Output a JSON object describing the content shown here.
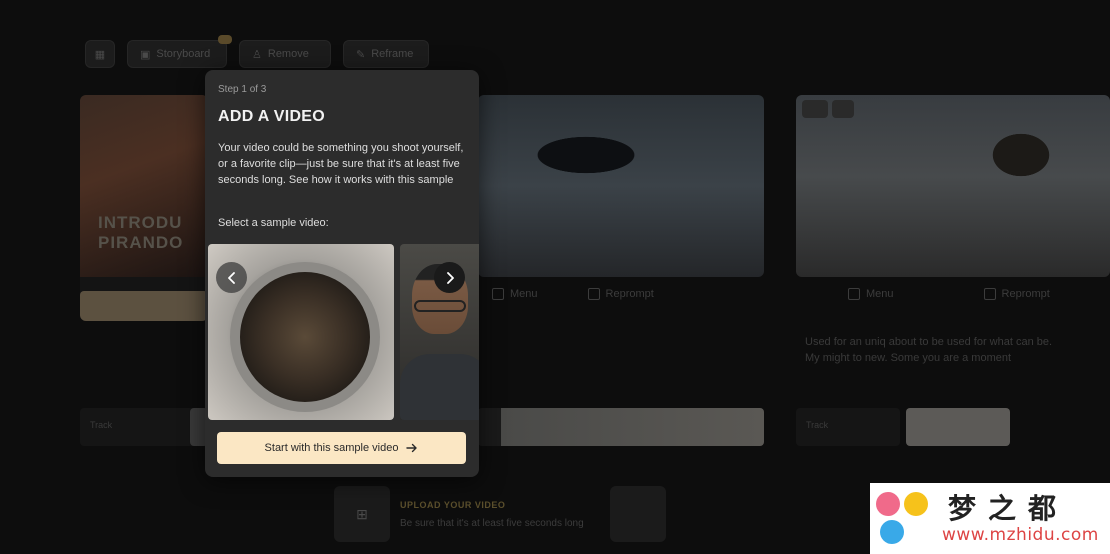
{
  "background": {
    "toolbar": {
      "pill_1": "Storyboard",
      "pill_2": "Remove",
      "pill_3": "Reframe"
    },
    "card1_text": "INTRODU\nPIRANDO",
    "cards": [
      {
        "action_1": "Menu",
        "action_2": "Reprompt"
      },
      {
        "action_1": "Menu",
        "action_2": "Reprompt"
      }
    ],
    "card3_desc": "Used for an uniq about to be used for what can be.\nMy might to new. Some you are a moment",
    "row_labels": [
      "Track",
      "Track",
      "Track"
    ],
    "upload": {
      "title": "UPLOAD YOUR VIDEO",
      "subtitle": "Be sure that it's at least five seconds long"
    }
  },
  "onboarding": {
    "step": "Step 1 of 3",
    "title": "ADD A VIDEO",
    "body": "Your video could be something you shoot yourself, or a favorite clip—just be sure that it's at least five seconds long. See how it works with this sample",
    "select_label": "Select a sample video:",
    "cta_label": "Start with this sample video"
  },
  "watermark": {
    "brand": "梦之都",
    "url": "www.mzhidu.com"
  },
  "colors": {
    "cta_bg": "#fbe7c4",
    "popover_bg": "#2c2c2c",
    "accent": "#5b4f2c"
  }
}
